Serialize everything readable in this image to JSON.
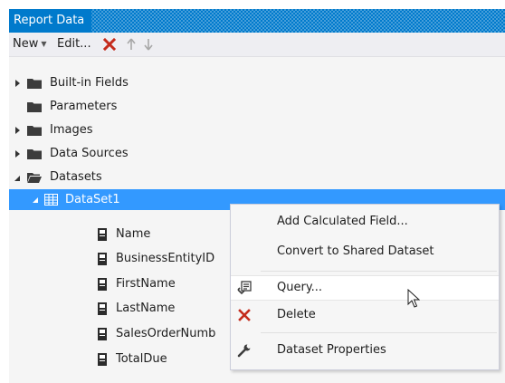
{
  "panel": {
    "title": "Report Data"
  },
  "toolbar": {
    "new_label": "New",
    "edit_label": "Edit...",
    "delete_icon": "red-x-icon",
    "move_up_icon": "arrow-up-icon",
    "move_down_icon": "arrow-down-icon"
  },
  "tree": {
    "built_in_fields": "Built-in Fields",
    "parameters": "Parameters",
    "images": "Images",
    "data_sources": "Data Sources",
    "datasets": "Datasets",
    "dataset1": "DataSet1",
    "fields": [
      "Name",
      "BusinessEntityID",
      "FirstName",
      "LastName",
      "SalesOrderNumb",
      "TotalDue"
    ]
  },
  "context_menu": {
    "add_calculated_field": "Add Calculated Field...",
    "convert_to_shared": "Convert to Shared Dataset",
    "query": "Query...",
    "delete": "Delete",
    "dataset_properties": "Dataset Properties"
  },
  "colors": {
    "accent": "#007acc",
    "selection": "#3399ff",
    "delete_red": "#c42b1c"
  }
}
